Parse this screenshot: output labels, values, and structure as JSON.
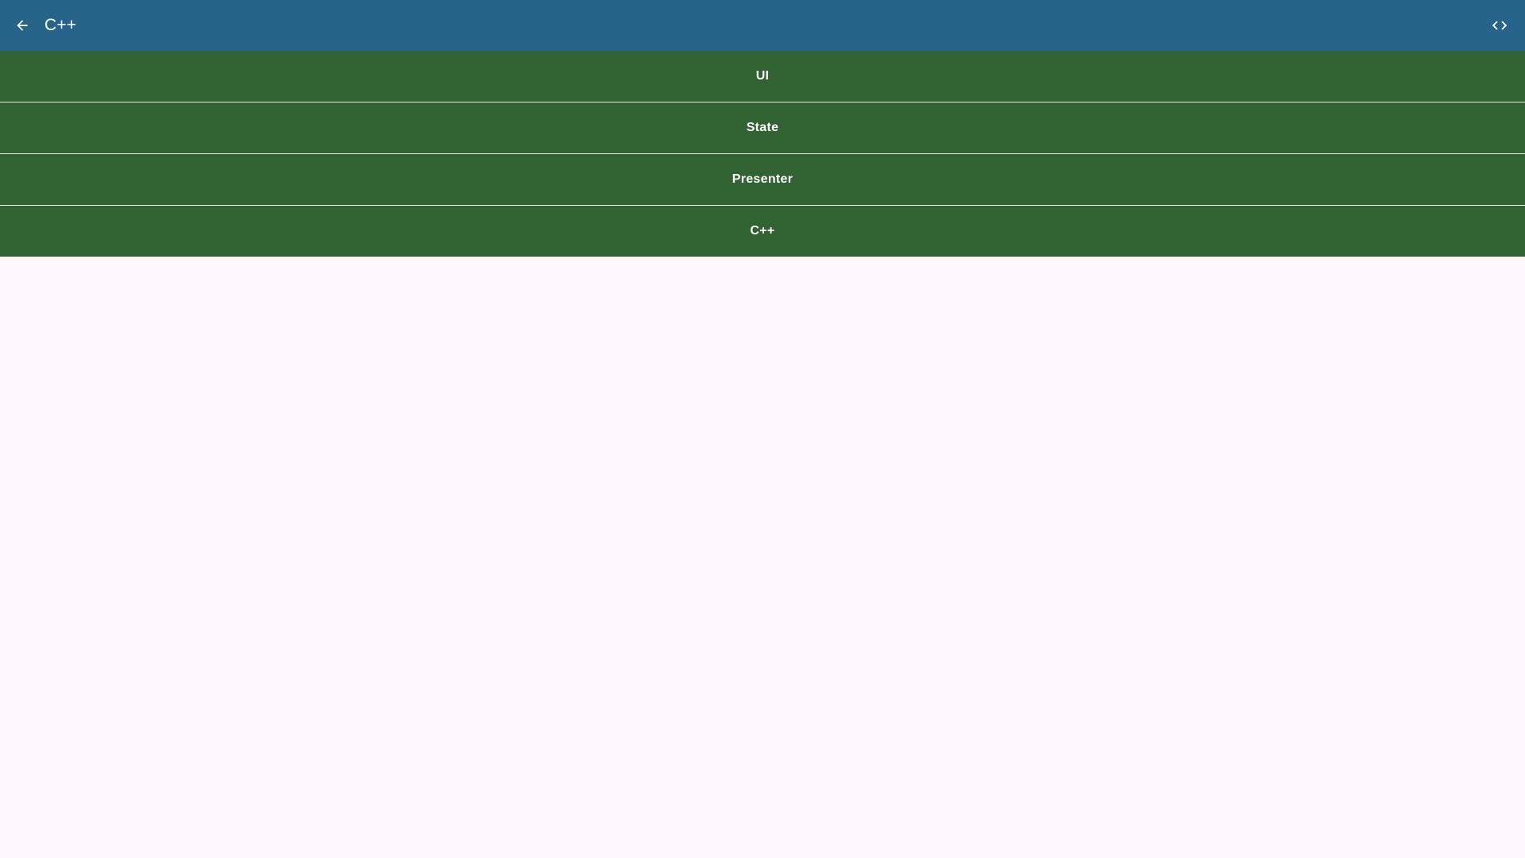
{
  "app_bar": {
    "title": "C++",
    "back_icon": "arrow-left-icon",
    "code_icon": "code-icon",
    "background": "#276489"
  },
  "list": {
    "background": "#316231",
    "items": [
      {
        "label": "UI"
      },
      {
        "label": "State"
      },
      {
        "label": "Presenter"
      },
      {
        "label": "C++"
      }
    ]
  },
  "page_background": "#fef7fc"
}
